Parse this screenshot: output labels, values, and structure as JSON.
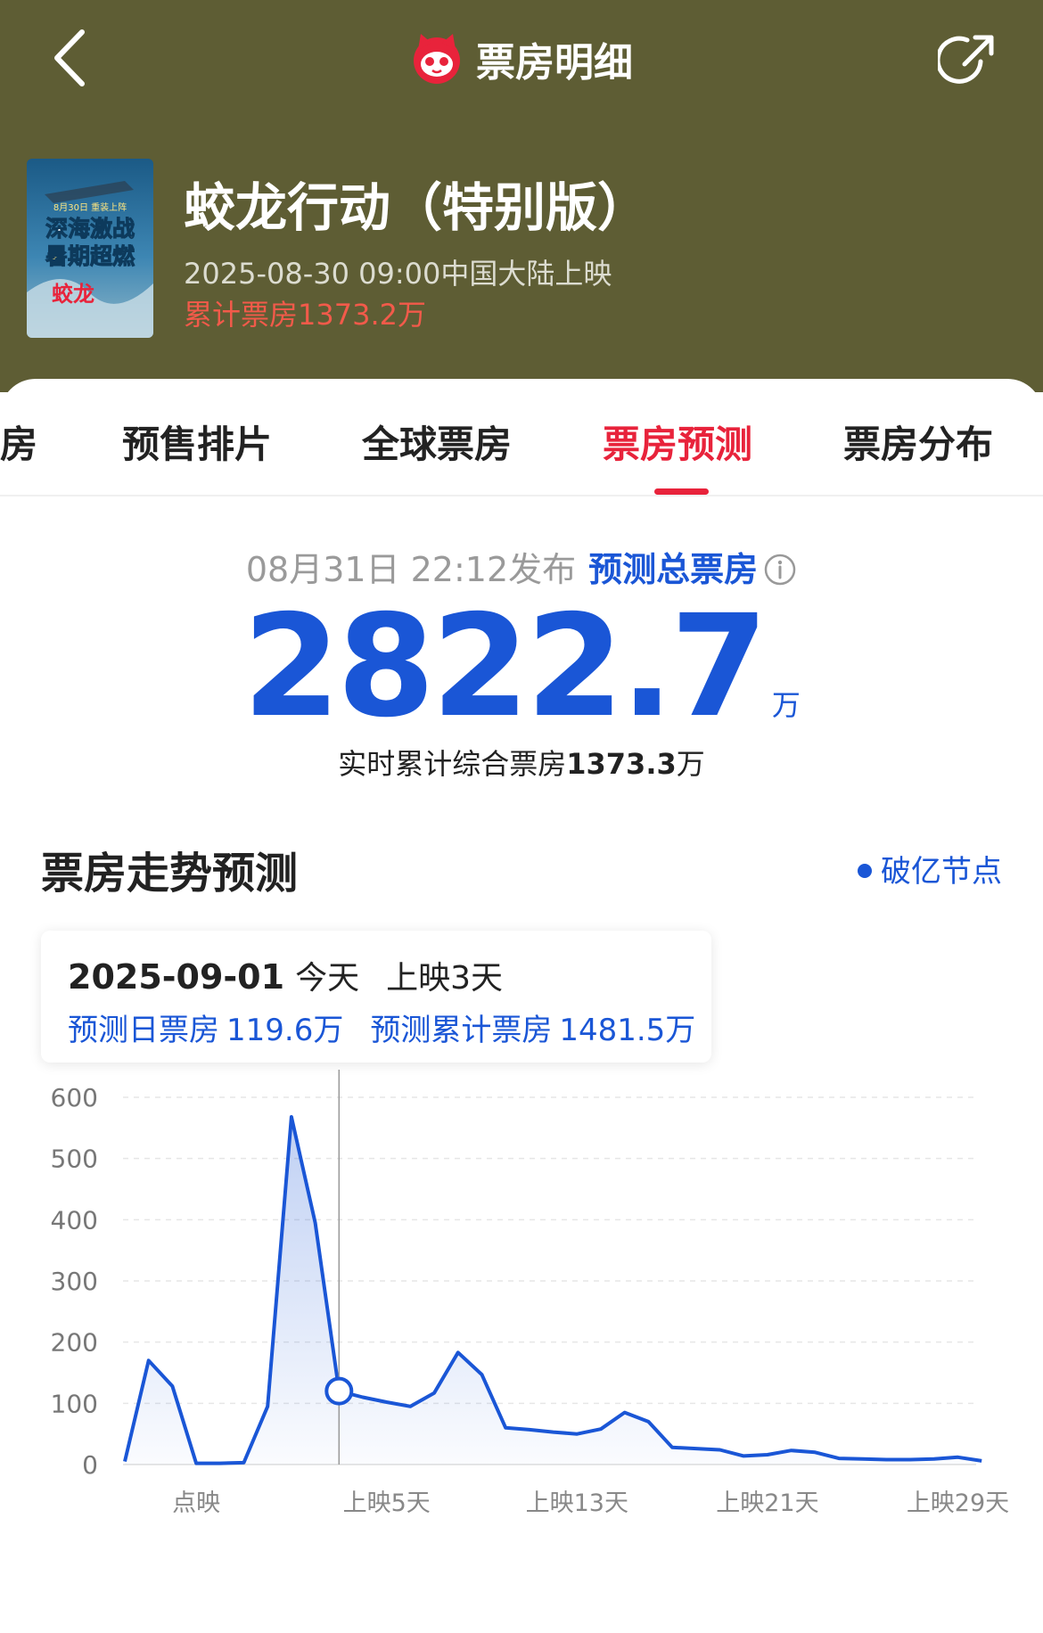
{
  "header": {
    "title": "票房明细",
    "back_icon": "chevron-left-icon",
    "share_icon": "share-icon",
    "logo_icon": "maoyan-cat-logo-icon"
  },
  "movie": {
    "name": "蛟龙行动（特别版）",
    "release": "2025-08-30 09:00中国大陆上映",
    "cumulative": "累计票房1373.2万",
    "poster": {
      "line1": "8月30日 重装上阵",
      "line2": "深海激战",
      "line3": "暑期超燃",
      "logo_text": "蛟龙"
    }
  },
  "tabs": [
    {
      "label": "房",
      "active": false
    },
    {
      "label": "预售排片",
      "active": false
    },
    {
      "label": "全球票房",
      "active": false
    },
    {
      "label": "票房预测",
      "active": true
    },
    {
      "label": "票房分布",
      "active": false
    }
  ],
  "forecast": {
    "published": "08月31日 22:12发布",
    "label": "预测总票房",
    "value": "2822.7",
    "unit": "万",
    "realtime_prefix": "实时累计综合票房",
    "realtime_value": "1373.3",
    "realtime_unit": "万"
  },
  "trend": {
    "title": "票房走势预测",
    "legend": "破亿节点",
    "tooltip": {
      "date": "2025-09-01",
      "today": "今天",
      "day": "上映3天",
      "daily_label": "预测日票房",
      "daily_value": "119.6万",
      "cum_label": "预测累计票房",
      "cum_value": "1481.5万"
    }
  },
  "colors": {
    "header_bg": "#5e5d34",
    "accent_red": "#e8233b",
    "primary_blue": "#1a56d6",
    "cumulative_red": "#f25a4a"
  },
  "chart_data": {
    "type": "area",
    "y_ticks": [
      "600",
      "500",
      "400",
      "300",
      "200",
      "100",
      "0"
    ],
    "ylim": [
      0,
      600
    ],
    "x_labels": [
      {
        "label": "点映",
        "index": 3
      },
      {
        "label": "上映5天",
        "index": 11
      },
      {
        "label": "上映13天",
        "index": 19
      },
      {
        "label": "上映21天",
        "index": 27
      },
      {
        "label": "上映29天",
        "index": 35
      }
    ],
    "grid": "horizontal-dashed",
    "values": [
      5,
      170,
      128,
      2,
      2,
      3,
      95,
      568,
      395,
      120,
      110,
      102,
      95,
      117,
      183,
      147,
      60,
      57,
      53,
      50,
      58,
      85,
      70,
      28,
      26,
      24,
      14,
      16,
      23,
      20,
      10,
      9,
      8,
      8,
      9,
      12,
      6
    ],
    "highlight_index": 9
  }
}
